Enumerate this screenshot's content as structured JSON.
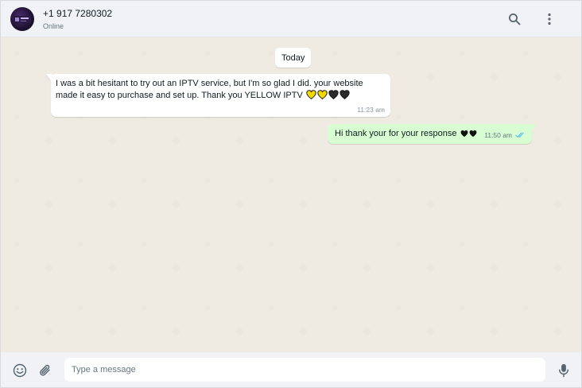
{
  "header": {
    "contact_name": "+1 917 7280302",
    "status": "Online",
    "icons": [
      "search-icon",
      "menu-icon"
    ]
  },
  "chat": {
    "date_separator": "Today",
    "messages": [
      {
        "direction": "incoming",
        "text": " I was a bit hesitant to try out an IPTV service, but I'm so glad I did. your website made it easy to purchase and set up. Thank you YELLOW IPTV",
        "emoji": [
          "yellow-heart",
          "yellow-heart",
          "black-heart",
          "black-heart"
        ],
        "time": "11:23 am"
      },
      {
        "direction": "outgoing",
        "text": "Hi thank your for your response",
        "emoji": [
          "black-heart",
          "black-heart"
        ],
        "time": "11:50 am",
        "status": "read"
      }
    ]
  },
  "composer": {
    "placeholder": "Type a message",
    "value": "",
    "icons": [
      "emoji-icon",
      "attach-icon",
      "mic-icon"
    ]
  },
  "colors": {
    "header_bg": "#f0f2f5",
    "chat_bg": "#efeae2",
    "incoming_bubble": "#ffffff",
    "outgoing_bubble": "#d9fdd3",
    "read_ticks": "#53bdeb",
    "yellow_heart": "#f5d800",
    "black_heart": "#1a1a1a"
  }
}
